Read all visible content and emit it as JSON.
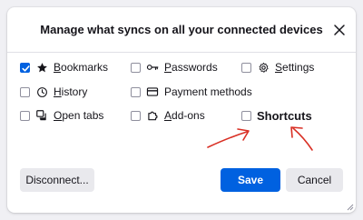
{
  "dialog": {
    "title": "Manage what syncs on all your connected devices",
    "close_icon": "close-icon"
  },
  "options": [
    {
      "id": "bookmarks",
      "label": "Bookmarks",
      "checked": true,
      "icon": "star-icon"
    },
    {
      "id": "passwords",
      "label": "Passwords",
      "checked": false,
      "icon": "key-icon"
    },
    {
      "id": "settings",
      "label": "Settings",
      "checked": false,
      "icon": "gear-icon"
    },
    {
      "id": "history",
      "label": "History",
      "checked": false,
      "icon": "clock-icon"
    },
    {
      "id": "payment-methods",
      "label": "Payment methods",
      "checked": false,
      "icon": "credit-card-icon"
    },
    {
      "id": "open-tabs",
      "label": "Open tabs",
      "checked": false,
      "icon": "tabs-icon"
    },
    {
      "id": "add-ons",
      "label": "Add-ons",
      "checked": false,
      "icon": "puzzle-icon"
    },
    {
      "id": "shortcuts",
      "label": "Shortcuts",
      "checked": false,
      "icon": ""
    }
  ],
  "buttons": {
    "disconnect": "Disconnect...",
    "save": "Save",
    "cancel": "Cancel"
  },
  "colors": {
    "accent": "#0061e0",
    "annotation": "#d93025"
  }
}
